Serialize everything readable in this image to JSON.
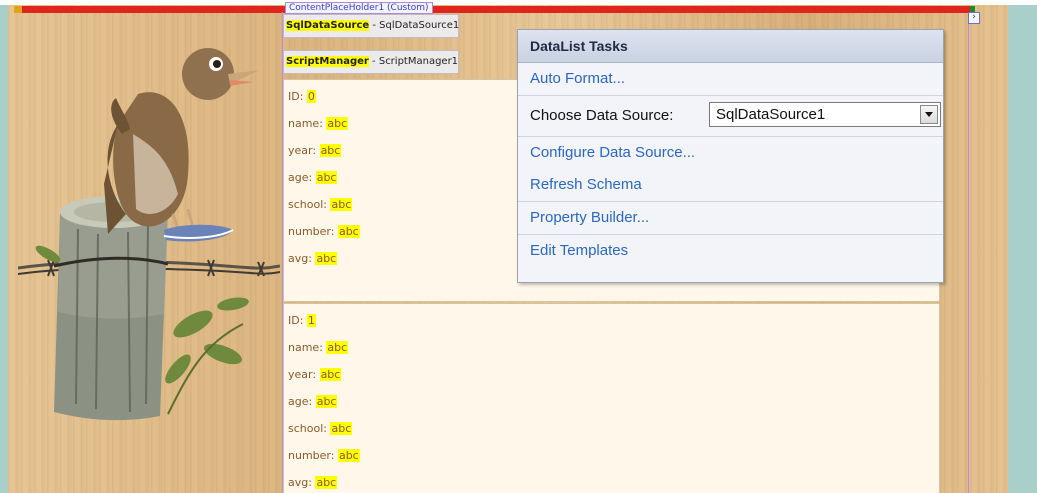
{
  "designer": {
    "content_placeholder_label": "ContentPlaceHolder1 (Custom)"
  },
  "controls": {
    "sql_name": "SqlDataSource",
    "sql_id": " - SqlDataSource1",
    "script_name": "ScriptManager",
    "script_id": " - ScriptManager1"
  },
  "datalist": {
    "items": [
      {
        "fields": [
          {
            "label": "ID: ",
            "value": "0"
          },
          {
            "label": "name: ",
            "value": "abc"
          },
          {
            "label": "year: ",
            "value": "abc"
          },
          {
            "label": "age: ",
            "value": "abc"
          },
          {
            "label": "school: ",
            "value": "abc"
          },
          {
            "label": "number: ",
            "value": "abc"
          },
          {
            "label": "avg: ",
            "value": "abc"
          }
        ]
      },
      {
        "fields": [
          {
            "label": "ID: ",
            "value": "1"
          },
          {
            "label": "name: ",
            "value": "abc"
          },
          {
            "label": "year: ",
            "value": "abc"
          },
          {
            "label": "age: ",
            "value": "abc"
          },
          {
            "label": "school: ",
            "value": "abc"
          },
          {
            "label": "number: ",
            "value": "abc"
          },
          {
            "label": "avg: ",
            "value": "abc"
          }
        ]
      }
    ]
  },
  "tasks_panel": {
    "title": "DataList Tasks",
    "auto_format": "Auto Format...",
    "choose_label": "Choose Data Source:",
    "choose_value": "SqlDataSource1",
    "configure": "Configure Data Source...",
    "refresh": "Refresh Schema",
    "property_builder": "Property Builder...",
    "edit_templates": "Edit Templates"
  },
  "smart_tag_glyph": "›",
  "colors": {
    "highlight": "#ffff00",
    "link": "#2a67c6",
    "field_text": "#8a5a28"
  },
  "icons": {
    "dropdown": "chevron-down-icon",
    "smart_tag": "smart-tag-arrow-icon",
    "bird": "bird-illustration"
  }
}
